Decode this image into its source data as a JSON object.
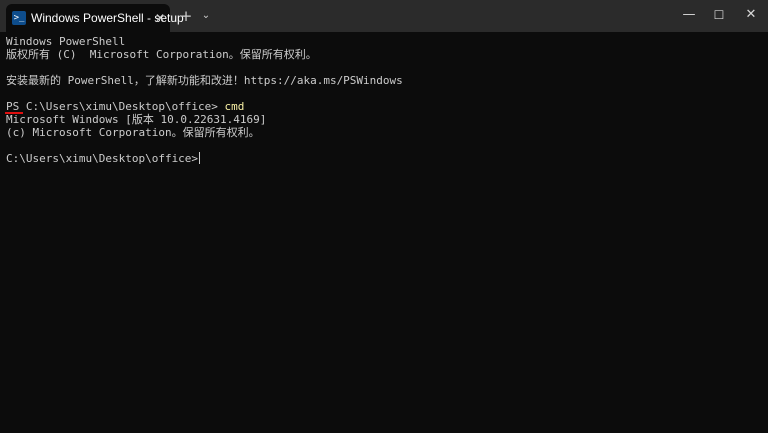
{
  "titlebar": {
    "tab_title": "Windows PowerShell - setup",
    "tab_icon_glyph": ">_",
    "tab_close": "✕",
    "new_tab": "+",
    "dropdown": "⌄",
    "minimize": "—",
    "maximize": "☐",
    "close": "✕"
  },
  "terminal": {
    "lines": [
      "Windows PowerShell",
      "版权所有 (C)  Microsoft Corporation。保留所有权利。",
      "",
      "安装最新的 PowerShell，了解新功能和改进！https://aka.ms/PSWindows",
      "",
      "",
      "Microsoft Windows [版本 10.0.22631.4169]",
      "(c) Microsoft Corporation。保留所有权利。",
      "",
      "C:\\Users\\ximu\\Desktop\\office>"
    ],
    "prompt": "PS C:\\Users\\ximu\\Desktop\\office> ",
    "command": "cmd"
  },
  "colors": {
    "background": "#0c0c0c",
    "titlebar": "#2b2b2b",
    "text": "#cccccc",
    "command": "#f9f1a5",
    "annotation": "#e01010"
  }
}
